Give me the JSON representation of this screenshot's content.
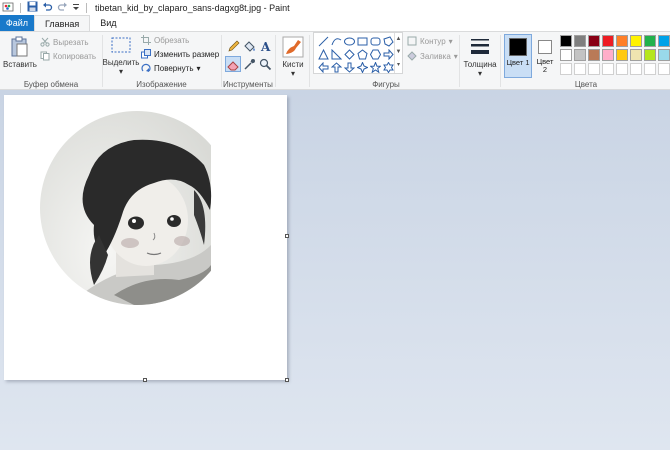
{
  "title_bar": {
    "title": "tibetan_kid_by_claparo_sans-dagxg8t.jpg - Paint"
  },
  "tabs": [
    {
      "label": "Файл"
    },
    {
      "label": "Главная"
    },
    {
      "label": "Вид"
    }
  ],
  "clipboard": {
    "paste_label": "Вставить",
    "cut_label": "Вырезать",
    "copy_label": "Копировать",
    "group_label": "Буфер обмена"
  },
  "image": {
    "select_label": "Выделить",
    "crop_label": "Обрезать",
    "resize_label": "Изменить размер",
    "rotate_label": "Повернуть",
    "group_label": "Изображение"
  },
  "tools": {
    "group_label": "Инструменты"
  },
  "brushes": {
    "label": "Кисти"
  },
  "shapes": {
    "outline_label": "Контур",
    "fill_label": "Заливка",
    "group_label": "Фигуры"
  },
  "size": {
    "label": "Толщина"
  },
  "colors": {
    "color1_label": "Цвет 1",
    "color2_label": "Цвет 2",
    "group_label": "Цвета",
    "color1": "#000000",
    "color2": "#ffffff",
    "palette_row1": [
      "#000000",
      "#7f7f7f",
      "#880015",
      "#ed1c24",
      "#ff7f27",
      "#fff200",
      "#22b14c",
      "#00a2e8"
    ],
    "palette_row2": [
      "#ffffff",
      "#c3c3c3",
      "#b97a57",
      "#ffaec9",
      "#ffc90e",
      "#efe4b0",
      "#b5e61d",
      "#99d9ea"
    ]
  },
  "theme": {
    "accent": "#1979ca",
    "ribbon_bg": "#f5f6f7",
    "workspace_bg": "#cdd7e6"
  }
}
